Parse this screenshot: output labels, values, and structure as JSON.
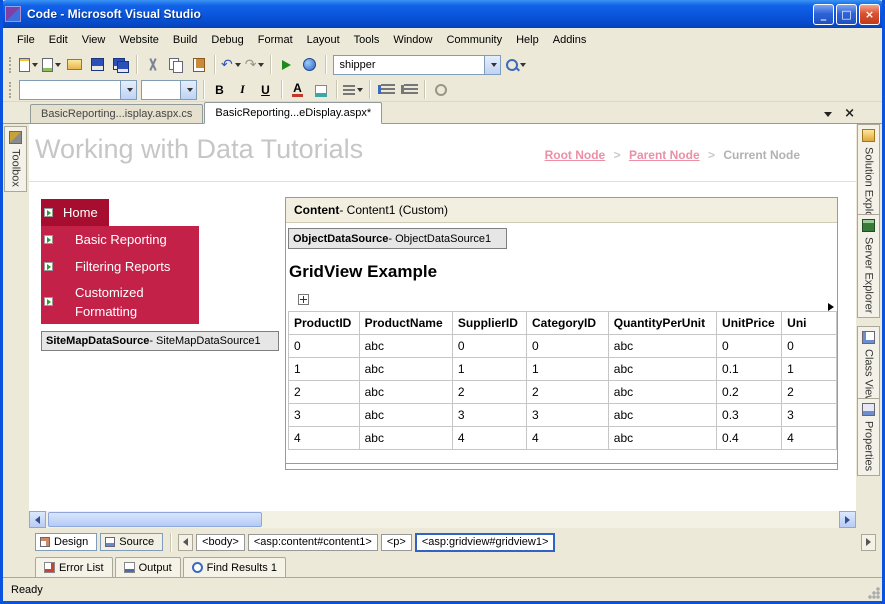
{
  "window": {
    "title": "Code - Microsoft Visual Studio"
  },
  "icons": {
    "minimize": "_",
    "maximize": "□",
    "close": "×",
    "undo": "↶",
    "redo": "↷"
  },
  "menu": {
    "items": [
      "File",
      "Edit",
      "View",
      "Website",
      "Build",
      "Debug",
      "Format",
      "Layout",
      "Tools",
      "Window",
      "Community",
      "Help",
      "Addins"
    ]
  },
  "toolbar": {
    "find_value": "shipper",
    "bold": "B",
    "italic": "I",
    "underline": "U",
    "font_color": "A"
  },
  "doc_tabs": [
    {
      "label": "BasicReporting...isplay.aspx.cs"
    },
    {
      "label": "BasicReporting...eDisplay.aspx*"
    }
  ],
  "toolbox_label": "Toolbox",
  "side_tabs": [
    "Solution Explorer",
    "Server Explorer",
    "Class View",
    "Properties"
  ],
  "design": {
    "page_title": "Working with Data Tutorials",
    "breadcrumb": {
      "root": "Root Node",
      "parent": "Parent Node",
      "current": "Current Node",
      "sep": ">"
    },
    "nav": {
      "home": "Home",
      "items": [
        "Basic Reporting",
        "Filtering Reports",
        "Customized Formatting"
      ]
    },
    "sitemap": {
      "bold": "SiteMapDataSource",
      "rest": " - SiteMapDataSource1"
    },
    "content": {
      "bold": "Content",
      "rest": " - Content1 (Custom)"
    },
    "ods": {
      "bold": "ObjectDataSource",
      "rest": " - ObjectDataSource1"
    },
    "gridview_title": "GridView Example",
    "table": {
      "headers": [
        "ProductID",
        "ProductName",
        "SupplierID",
        "CategoryID",
        "QuantityPerUnit",
        "UnitPrice",
        "Uni"
      ],
      "rows": [
        [
          "0",
          "abc",
          "0",
          "0",
          "abc",
          "0",
          "0"
        ],
        [
          "1",
          "abc",
          "1",
          "1",
          "abc",
          "0.1",
          "1"
        ],
        [
          "2",
          "abc",
          "2",
          "2",
          "abc",
          "0.2",
          "2"
        ],
        [
          "3",
          "abc",
          "3",
          "3",
          "abc",
          "0.3",
          "3"
        ],
        [
          "4",
          "abc",
          "4",
          "4",
          "abc",
          "0.4",
          "4"
        ]
      ]
    }
  },
  "viewbar": {
    "design": "Design",
    "source": "Source",
    "tags": [
      "<body>",
      "<asp:content#content1>",
      "<p>",
      "<asp:gridview#gridview1>"
    ]
  },
  "panel_tabs": [
    "Error List",
    "Output",
    "Find Results 1"
  ],
  "status": "Ready"
}
